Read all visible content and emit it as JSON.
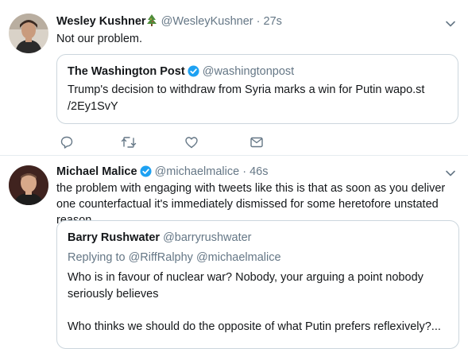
{
  "tweets": [
    {
      "author_name": "Wesley Kushner",
      "author_emoji": "christmas-tree-icon",
      "author_handle": "@WesleyKushner",
      "separator": "·",
      "time": "27s",
      "text": "Not our problem.",
      "quote": {
        "author_name": "The Washington Post",
        "author_handle": "@washingtonpost",
        "verified": true,
        "text": "Trump's decision to withdraw from Syria marks a win for Putin wapo.st /2Ey1SvY"
      },
      "actions": [
        "reply-icon",
        "retweet-icon",
        "like-icon",
        "message-icon"
      ]
    },
    {
      "author_name": "Michael Malice",
      "verified": true,
      "author_handle": "@michaelmalice",
      "separator": "·",
      "time": "46s",
      "text": "the problem with engaging with tweets like this is that as soon as you deliver one counterfactual it's immediately dismissed for some heretofore unstated reason.",
      "quote": {
        "author_name": "Barry Rushwater",
        "author_handle": "@barryrushwater",
        "replying_label": "Replying to",
        "replying_to": "@RiffRalphy @michaelmalice",
        "text_p1": "Who is in favour of nuclear war? Nobody, your arguing a point nobody seriously believes",
        "text_p2": "Who thinks we should do the opposite of what Putin prefers reflexively?..."
      }
    }
  ],
  "colors": {
    "text": "#14171a",
    "secondary": "#657786",
    "verified": "#1da1f2",
    "border": "#ccd6dd"
  }
}
